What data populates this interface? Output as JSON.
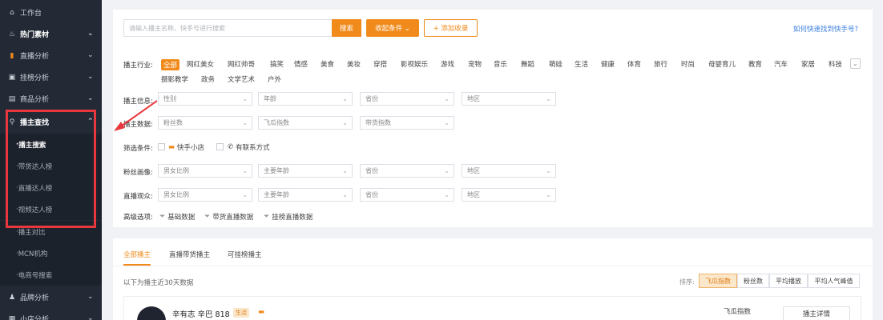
{
  "sidebar": {
    "items": [
      {
        "label": "工作台",
        "icon": "home-icon",
        "chev": ""
      },
      {
        "label": "热门素材",
        "icon": "flame-icon",
        "chev": "⌄"
      },
      {
        "label": "直播分析",
        "icon": "bar-chart-icon",
        "chev": "⌄"
      },
      {
        "label": "挂榜分析",
        "icon": "chart-icon",
        "chev": "⌄"
      },
      {
        "label": "商品分析",
        "icon": "box-icon",
        "chev": "⌄"
      },
      {
        "label": "播主查找",
        "icon": "search-icon",
        "chev": "⌃"
      }
    ],
    "subitems": [
      "播主搜索",
      "带货达人榜",
      "直播达人榜",
      "视频达人榜"
    ],
    "extra": [
      "播主对比",
      "MCN机构",
      "电商号搜索"
    ],
    "bottom": [
      {
        "label": "品牌分析",
        "icon": "brand-icon",
        "chev": "⌄"
      },
      {
        "label": "小店分析",
        "icon": "store-icon",
        "chev": "⌄"
      }
    ]
  },
  "search": {
    "placeholder": "请输入播主名称、快手号进行搜索",
    "search_label": "搜索",
    "collapse_label": "收起条件 ⌄",
    "add_label": "+ 添加收录",
    "help_link": "如何快速找到快手号?"
  },
  "filters": {
    "industry_label": "播主行业:",
    "industry_tags_row1": [
      "全部",
      "网红美女",
      "网红帅哥",
      "搞笑",
      "情感",
      "美食",
      "美妆",
      "穿搭",
      "影视娱乐",
      "游戏",
      "宠物",
      "音乐",
      "舞蹈",
      "萌娃",
      "生活",
      "健康",
      "体育",
      "旅行",
      "时尚",
      "母婴育儿",
      "教育",
      "汽车",
      "家居",
      "科技"
    ],
    "industry_tags_row2": [
      "摄影教学",
      "政务",
      "文学艺术",
      "户外"
    ],
    "info_label": "播主信息:",
    "info_selects": [
      "性别",
      "年龄",
      "省份",
      "地区"
    ],
    "data_label": "播主数据:",
    "data_selects": [
      "粉丝数",
      "飞瓜指数",
      "带货指数"
    ],
    "condition_label": "筛选条件:",
    "conditions": [
      "快手小店",
      "有联系方式"
    ],
    "fans_label": "粉丝画像:",
    "fans_selects": [
      "男女比例",
      "主要年龄",
      "省份",
      "地区"
    ],
    "audience_label": "直播观众:",
    "audience_selects": [
      "男女比例",
      "主要年龄",
      "省份",
      "地区"
    ],
    "advanced_label": "高级选项:",
    "advanced": [
      "基础数据",
      "带货直播数据",
      "挂榜直播数据"
    ]
  },
  "results": {
    "tabs": [
      "全部播主",
      "直播带货播主",
      "可挂榜播主"
    ],
    "note": "以下为播主近30天数据",
    "sort_label": "排序:",
    "sort_options": [
      "飞瓜指数",
      "粉丝数",
      "平均播放",
      "平均人气峰值"
    ],
    "first": {
      "name": "辛有志 辛巴 818",
      "badge": "生活",
      "metric_label": "飞瓜指数",
      "detail_label": "播主详情"
    }
  },
  "colors": {
    "accent": "#f08a1b",
    "sidebar": "#232a36",
    "highlight": "#e8383d",
    "link": "#3a7ee0"
  }
}
